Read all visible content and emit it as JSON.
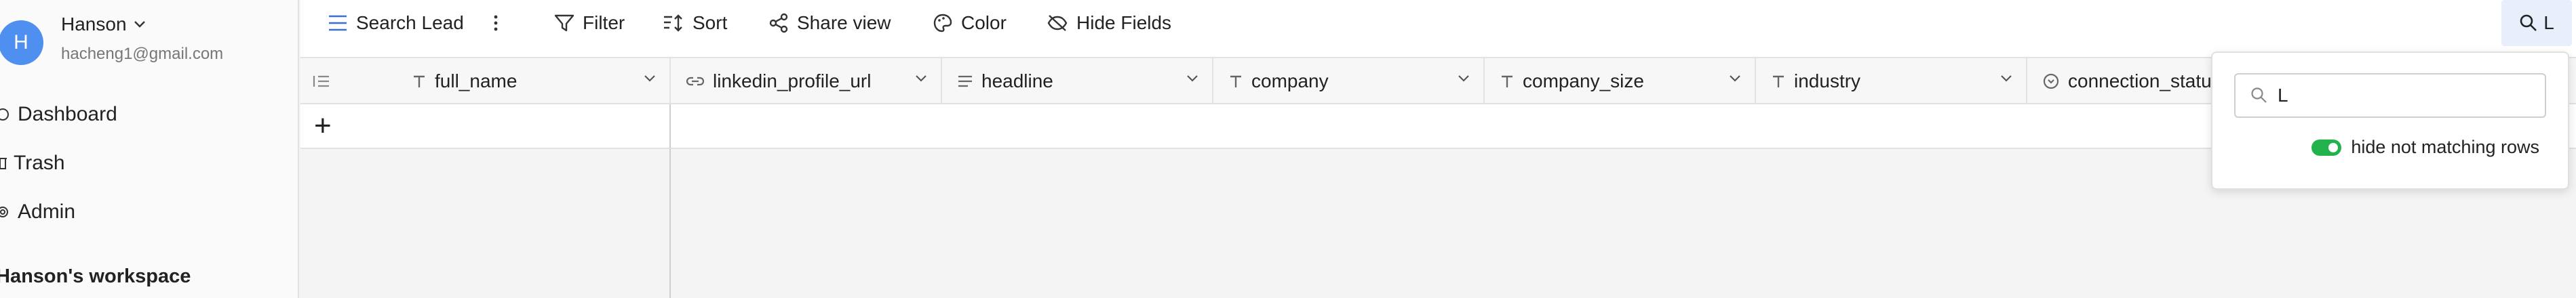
{
  "sidebar": {
    "user_initial": "H",
    "user_name": "Hanson",
    "user_email": "hacheng1@gmail.com",
    "nav": [
      {
        "label": "Dashboard",
        "icon": "dashboard-icon"
      },
      {
        "label": "Trash",
        "icon": "trash-icon"
      },
      {
        "label": "Admin",
        "icon": "gear-icon"
      }
    ],
    "workspace_label": "Hanson's workspace"
  },
  "toolbar": {
    "table_name": "Search Lead",
    "filter": "Filter",
    "sort": "Sort",
    "share_view": "Share view",
    "color": "Color",
    "hide_fields": "Hide Fields",
    "search_value": "L"
  },
  "grid": {
    "columns": [
      {
        "label": "full_name",
        "icon": "text-type-icon"
      },
      {
        "label": "linkedin_profile_url",
        "icon": "link-type-icon"
      },
      {
        "label": "headline",
        "icon": "long-text-type-icon"
      },
      {
        "label": "company",
        "icon": "text-type-icon"
      },
      {
        "label": "company_size",
        "icon": "text-type-icon"
      },
      {
        "label": "industry",
        "icon": "text-type-icon"
      },
      {
        "label": "connection_status",
        "icon": "select-type-icon"
      }
    ],
    "add_row": "+"
  },
  "search_popover": {
    "query": "L",
    "hide_not_matching_label": "hide not matching rows",
    "hide_not_matching_on": true
  },
  "colors": {
    "accent": "#4f8ff0",
    "toggle_on": "#22b24c",
    "search_button_bg": "#e9eefb"
  }
}
